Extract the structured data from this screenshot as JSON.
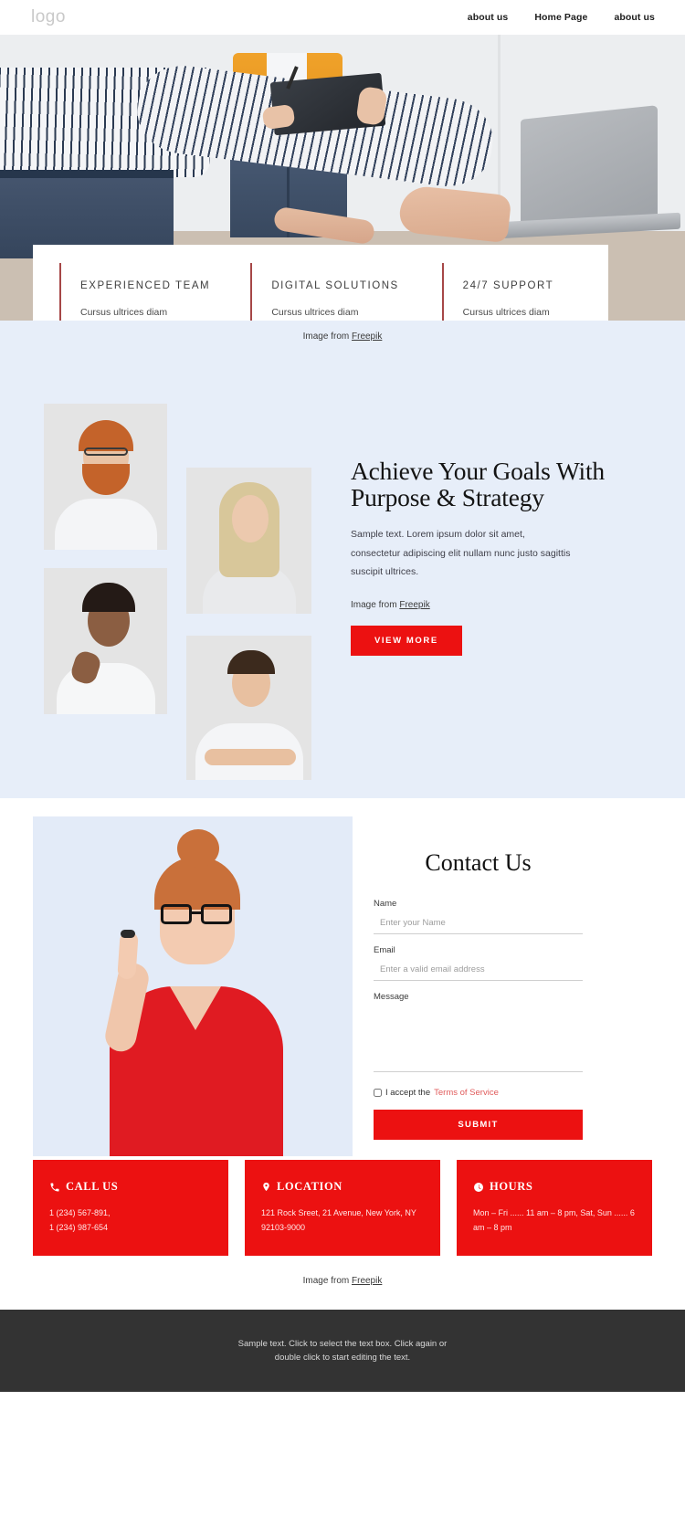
{
  "header": {
    "logo": "logo",
    "nav": [
      {
        "label": "about us"
      },
      {
        "label": "Home Page"
      },
      {
        "label": "about us"
      }
    ]
  },
  "hero": {
    "features": [
      {
        "title": "EXPERIENCED TEAM",
        "subtitle": "Cursus ultrices diam"
      },
      {
        "title": "DIGITAL SOLUTIONS",
        "subtitle": "Cursus ultrices diam"
      },
      {
        "title": "24/7 SUPPORT",
        "subtitle": "Cursus ultrices diam"
      }
    ],
    "credit_prefix": "Image from ",
    "credit_link": "Freepik"
  },
  "team": {
    "heading": "Achieve Your Goals With Purpose & Strategy",
    "paragraph": "Sample text. Lorem ipsum dolor sit amet, consectetur adipiscing elit nullam nunc justo sagittis suscipit ultrices.",
    "credit_prefix": "Image from ",
    "credit_link": "Freepik",
    "button": "VIEW MORE"
  },
  "contact": {
    "heading": "Contact Us",
    "fields": {
      "name_label": "Name",
      "name_placeholder": "Enter your Name",
      "name_value": "",
      "email_label": "Email",
      "email_placeholder": "Enter a valid email address",
      "email_value": "",
      "message_label": "Message",
      "message_placeholder": "",
      "message_value": ""
    },
    "terms_prefix": "I accept the ",
    "terms_link": "Terms of Service",
    "terms_checked": false,
    "submit": "SUBMIT",
    "cards": [
      {
        "icon": "phone-icon",
        "title": "CALL US",
        "lines": "1 (234) 567-891,\n1 (234) 987-654"
      },
      {
        "icon": "location-pin-icon",
        "title": "LOCATION",
        "lines": "121 Rock Sreet, 21 Avenue, New York, NY 92103-9000"
      },
      {
        "icon": "clock-icon",
        "title": "HOURS",
        "lines": "Mon – Fri ...... 11 am – 8 pm, Sat, Sun  ...... 6 am – 8 pm"
      }
    ],
    "credit_prefix": "Image from ",
    "credit_link": "Freepik"
  },
  "footer": {
    "text": "Sample text. Click to select the text box. Click again or double click to start editing the text."
  },
  "colors": {
    "accent_red": "#ec1111",
    "band_blue": "#e7eef9",
    "footer_dark": "#333333",
    "feature_rule": "#a64747",
    "terms_link": "#e05a5a"
  }
}
